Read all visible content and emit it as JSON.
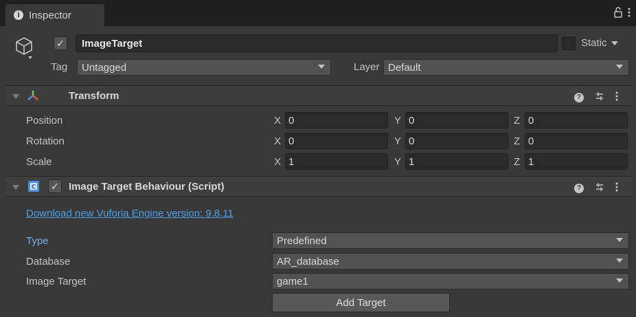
{
  "tab": {
    "label": "Inspector",
    "lock_icon": "lock-icon",
    "menu_icon": "kebab-menu-icon"
  },
  "header": {
    "icon": "cube-icon",
    "active": true,
    "name": "ImageTarget",
    "static_label": "Static",
    "tag_label": "Tag",
    "tag_value": "Untagged",
    "layer_label": "Layer",
    "layer_value": "Default"
  },
  "transform": {
    "title": "Transform",
    "icon": "transform-axes-icon",
    "rows": [
      {
        "label": "Position",
        "x": "0",
        "y": "0",
        "z": "0"
      },
      {
        "label": "Rotation",
        "x": "0",
        "y": "0",
        "z": "0"
      },
      {
        "label": "Scale",
        "x": "1",
        "y": "1",
        "z": "1"
      }
    ],
    "axis_labels": {
      "x": "X",
      "y": "Y",
      "z": "Z"
    }
  },
  "behaviour": {
    "title": "Image Target Behaviour (Script)",
    "icon": "csharp-script-icon",
    "enabled": true,
    "download_link": "Download new Vuforia Engine version: 9.8.11",
    "type_label": "Type",
    "type_value": "Predefined",
    "database_label": "Database",
    "database_value": "AR_database",
    "image_target_label": "Image Target",
    "image_target_value": "game1",
    "add_target_label": "Add Target"
  },
  "colors": {
    "background": "#383838",
    "link": "#4c9fe8",
    "accent_label": "#7bafe6",
    "field": "#2a2a2a"
  }
}
